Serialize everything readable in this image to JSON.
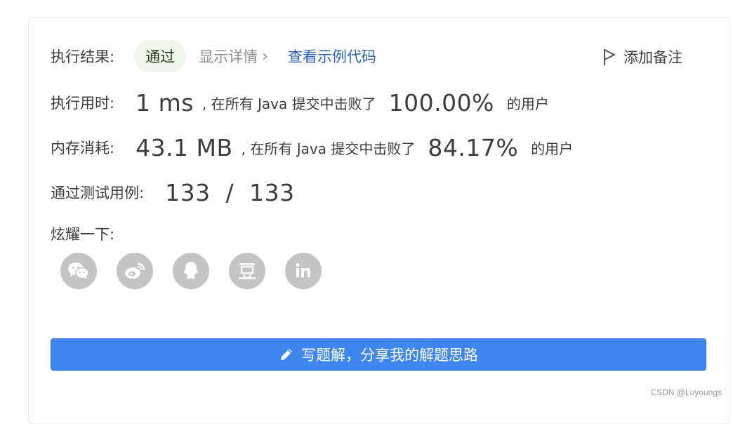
{
  "result": {
    "label": "执行结果:",
    "status": "通过",
    "details_link": "显示详情",
    "example_link": "查看示例代码",
    "note_button": "添加备注"
  },
  "runtime": {
    "label": "执行用时:",
    "value": "1 ms",
    "middle_text": ", 在所有 Java 提交中击败了",
    "percent": "100.00%",
    "suffix": "的用户"
  },
  "memory": {
    "label": "内存消耗:",
    "value": "43.1 MB",
    "middle_text": ", 在所有 Java 提交中击败了",
    "percent": "84.17%",
    "suffix": "的用户"
  },
  "tests": {
    "label": "通过测试用例:",
    "value": "133  /  133"
  },
  "share": {
    "label": "炫耀一下:",
    "icons": [
      "wechat-icon",
      "weibo-icon",
      "qq-icon",
      "douban-icon",
      "linkedin-icon"
    ]
  },
  "cta": {
    "label": "写题解，分享我的解题思路"
  },
  "watermark": "CSDN @Luyoungs",
  "colors": {
    "primary": "#3f86f0",
    "link": "#2b62b3",
    "pass_bg": "#f2f7ee",
    "icon_gray": "#c4c4c4"
  }
}
